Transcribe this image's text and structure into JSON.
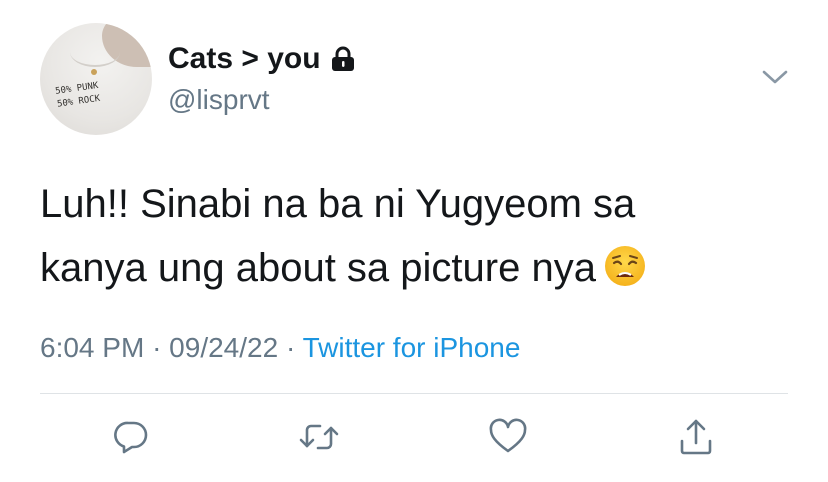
{
  "tweet": {
    "display_name": "Cats > you",
    "handle": "@lisprvt",
    "protected_icon": "lock-icon",
    "text_line1": "Luh!! Sinabi na ba ni Yugyeom sa",
    "text_line2": "kanya ung about sa picture nya",
    "emoji": "weary-face-emoji",
    "time": "6:04 PM",
    "date": "09/24/22",
    "source": "Twitter for iPhone",
    "sep": "·"
  },
  "avatar": {
    "shirt_text": "50% PUNK\n50% ROCK"
  },
  "actions": [
    {
      "icon": "reply-icon"
    },
    {
      "icon": "retweet-icon"
    },
    {
      "icon": "like-icon"
    },
    {
      "icon": "share-icon"
    }
  ],
  "colors": {
    "text": "#14171a",
    "secondary": "#657786",
    "link": "#1b95e0",
    "divider": "#dfe3e6"
  }
}
